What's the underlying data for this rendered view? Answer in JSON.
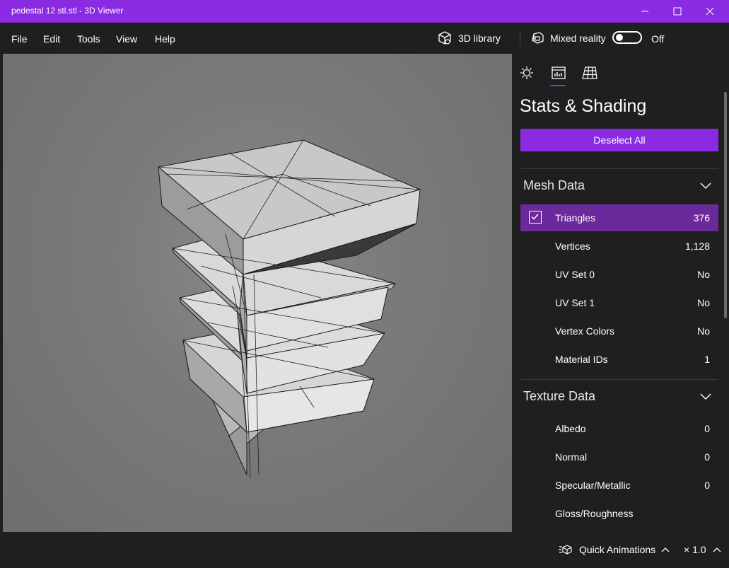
{
  "window": {
    "title": "pedestal 12 stl.stl - 3D Viewer"
  },
  "menu": [
    "File",
    "Edit",
    "Tools",
    "View",
    "Help"
  ],
  "toolbar": {
    "library_label": "3D library",
    "mixed_reality_label": "Mixed reality",
    "toggle_state": "Off"
  },
  "panel": {
    "title": "Stats & Shading",
    "deselect_label": "Deselect All",
    "mesh": {
      "heading": "Mesh Data",
      "rows": [
        {
          "label": "Triangles",
          "value": "376"
        },
        {
          "label": "Vertices",
          "value": "1,128"
        },
        {
          "label": "UV Set 0",
          "value": "No"
        },
        {
          "label": "UV Set 1",
          "value": "No"
        },
        {
          "label": "Vertex Colors",
          "value": "No"
        },
        {
          "label": "Material IDs",
          "value": "1"
        }
      ]
    },
    "texture": {
      "heading": "Texture Data",
      "rows": [
        {
          "label": "Albedo",
          "value": "0"
        },
        {
          "label": "Normal",
          "value": "0"
        },
        {
          "label": "Specular/Metallic",
          "value": "0"
        },
        {
          "label": "Gloss/Roughness",
          "value": ""
        }
      ]
    }
  },
  "status": {
    "animations_label": "Quick Animations",
    "speed": "× 1.0"
  },
  "colors": {
    "accent": "#8a2be2",
    "background": "#1f1f1f",
    "viewport": "#7a7a7a"
  }
}
